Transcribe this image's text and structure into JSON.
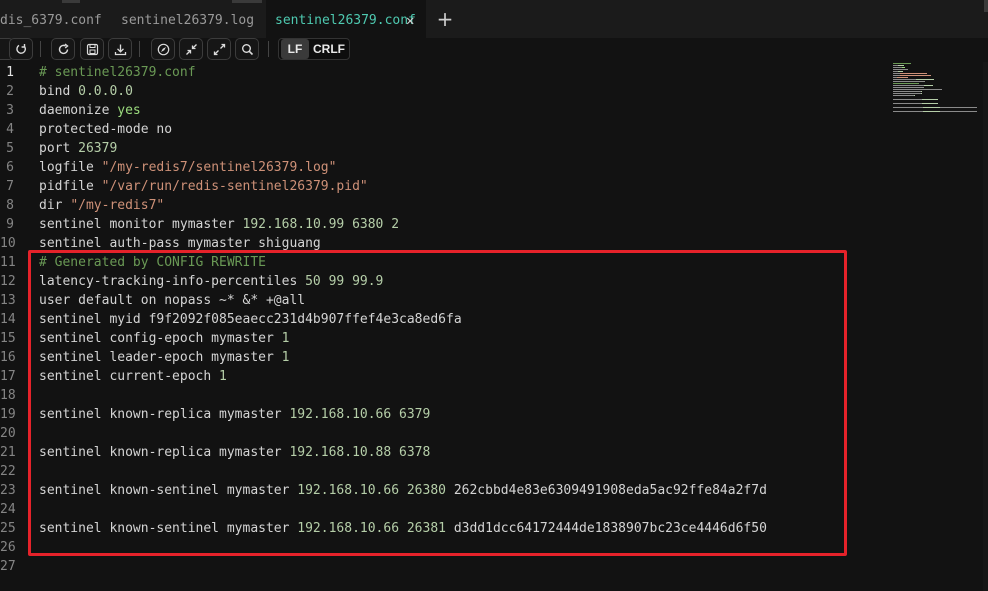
{
  "tabs": [
    {
      "label": "dis_6379.conf",
      "active": false
    },
    {
      "label": "sentinel26379.log",
      "active": false
    },
    {
      "label": "sentinel26379.conf",
      "active": true
    }
  ],
  "tab_close_glyph": "✕",
  "new_tab_glyph": "+",
  "toolbar": {
    "buttons": [
      "redo-icon",
      "reload-icon",
      "save-icon",
      "download-icon",
      "compass-icon",
      "collapse-icon",
      "expand-icon",
      "search-icon"
    ],
    "eol_options": [
      "LF",
      "CRLF"
    ],
    "eol_selected": "LF"
  },
  "editor": {
    "lines": [
      {
        "n": "1",
        "tokens": [
          {
            "t": "# sentinel26379.conf",
            "c": "comment"
          }
        ]
      },
      {
        "n": "2",
        "tokens": [
          {
            "t": "bind ",
            "c": "kw"
          },
          {
            "t": "0.0.0.0",
            "c": "num"
          }
        ]
      },
      {
        "n": "3",
        "tokens": [
          {
            "t": "daemonize ",
            "c": "kw"
          },
          {
            "t": "yes",
            "c": "yes"
          }
        ]
      },
      {
        "n": "4",
        "tokens": [
          {
            "t": "protected-mode no",
            "c": "kw"
          }
        ]
      },
      {
        "n": "5",
        "tokens": [
          {
            "t": "port ",
            "c": "kw"
          },
          {
            "t": "26379",
            "c": "num"
          }
        ]
      },
      {
        "n": "6",
        "tokens": [
          {
            "t": "logfile ",
            "c": "kw"
          },
          {
            "t": "\"/my-redis7/sentinel26379.log\"",
            "c": "str"
          }
        ]
      },
      {
        "n": "7",
        "tokens": [
          {
            "t": "pidfile ",
            "c": "kw"
          },
          {
            "t": "\"/var/run/redis-sentinel26379.pid\"",
            "c": "str"
          }
        ]
      },
      {
        "n": "8",
        "tokens": [
          {
            "t": "dir ",
            "c": "kw"
          },
          {
            "t": "\"/my-redis7\"",
            "c": "str"
          }
        ]
      },
      {
        "n": "9",
        "tokens": [
          {
            "t": "sentinel monitor mymaster ",
            "c": "kw"
          },
          {
            "t": "192.168.10.99 6380 2",
            "c": "num"
          }
        ]
      },
      {
        "n": "10",
        "tokens": [
          {
            "t": "sentinel auth-pass mymaster shiguang",
            "c": "kw"
          }
        ]
      },
      {
        "n": "11",
        "tokens": [
          {
            "t": "# Generated by CONFIG REWRITE",
            "c": "comment"
          }
        ]
      },
      {
        "n": "12",
        "tokens": [
          {
            "t": "latency-tracking-info-percentiles ",
            "c": "kw"
          },
          {
            "t": "50 99 99.9",
            "c": "num"
          }
        ]
      },
      {
        "n": "13",
        "tokens": [
          {
            "t": "user default on nopass ~* &* +@all",
            "c": "kw"
          }
        ]
      },
      {
        "n": "14",
        "tokens": [
          {
            "t": "sentinel myid f9f2092f085eaecc231d4b907ffef4e3ca8ed6fa",
            "c": "kw"
          }
        ]
      },
      {
        "n": "15",
        "tokens": [
          {
            "t": "sentinel config-epoch mymaster ",
            "c": "kw"
          },
          {
            "t": "1",
            "c": "num"
          }
        ]
      },
      {
        "n": "16",
        "tokens": [
          {
            "t": "sentinel leader-epoch mymaster ",
            "c": "kw"
          },
          {
            "t": "1",
            "c": "num"
          }
        ]
      },
      {
        "n": "17",
        "tokens": [
          {
            "t": "sentinel current-epoch ",
            "c": "kw"
          },
          {
            "t": "1",
            "c": "num"
          }
        ]
      },
      {
        "n": "18",
        "tokens": []
      },
      {
        "n": "19",
        "tokens": [
          {
            "t": "sentinel known-replica mymaster ",
            "c": "kw"
          },
          {
            "t": "192.168.10.66 6379",
            "c": "num"
          }
        ]
      },
      {
        "n": "20",
        "tokens": []
      },
      {
        "n": "21",
        "tokens": [
          {
            "t": "sentinel known-replica mymaster ",
            "c": "kw"
          },
          {
            "t": "192.168.10.88 6378",
            "c": "num"
          }
        ]
      },
      {
        "n": "22",
        "tokens": []
      },
      {
        "n": "23",
        "tokens": [
          {
            "t": "sentinel known-sentinel mymaster ",
            "c": "kw"
          },
          {
            "t": "192.168.10.66 26380",
            "c": "num"
          },
          {
            "t": " 262cbbd4e83e6309491908eda5ac92ffe84a2f7d",
            "c": "kw"
          }
        ]
      },
      {
        "n": "24",
        "tokens": []
      },
      {
        "n": "25",
        "tokens": [
          {
            "t": "sentinel known-sentinel mymaster ",
            "c": "kw"
          },
          {
            "t": "192.168.10.66 26381",
            "c": "num"
          },
          {
            "t": " d3dd1dcc64172444de1838907bc23ce4446d6f50",
            "c": "kw"
          }
        ]
      },
      {
        "n": "26",
        "tokens": []
      },
      {
        "n": "27",
        "tokens": []
      }
    ],
    "active_line": "1"
  },
  "colors": {
    "comment": "#6a9955",
    "string": "#ce9178",
    "number": "#b5cea8",
    "active_tab": "#4ec9b0",
    "highlight_box": "#e5222a"
  }
}
